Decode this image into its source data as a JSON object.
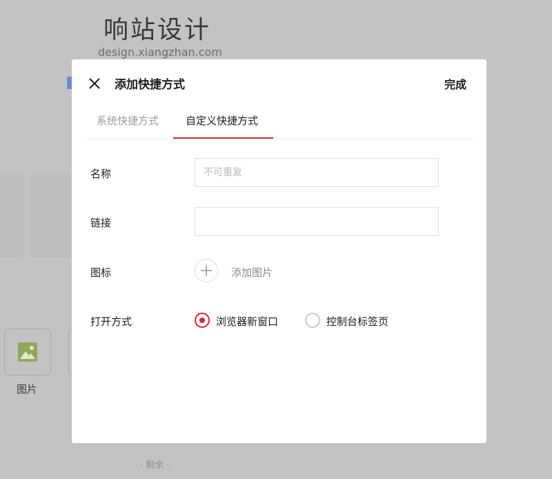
{
  "background": {
    "brand_title": "响站设计",
    "brand_url": "design.xiangzhan.com",
    "app_tile_label": "图片",
    "remaining_text": "· 剩余 ·"
  },
  "modal": {
    "title": "添加快捷方式",
    "done_label": "完成",
    "tabs": [
      {
        "label": "系统快捷方式",
        "active": false
      },
      {
        "label": "自定义快捷方式",
        "active": true
      }
    ],
    "form": {
      "name_label": "名称",
      "name_placeholder": "不可重复",
      "name_value": "",
      "link_label": "链接",
      "link_value": "",
      "icon_label": "图标",
      "add_image_label": "添加图片",
      "open_mode_label": "打开方式",
      "open_mode_options": [
        {
          "label": "浏览器新窗口",
          "selected": true
        },
        {
          "label": "控制台标签页",
          "selected": false
        }
      ]
    }
  },
  "icons": {
    "close": "close-icon",
    "plus": "plus-icon",
    "image": "image-icon"
  },
  "colors": {
    "accent": "#d8262e",
    "overlay_bg": "#c3c3c3",
    "image_icon": "#8fa85a"
  }
}
